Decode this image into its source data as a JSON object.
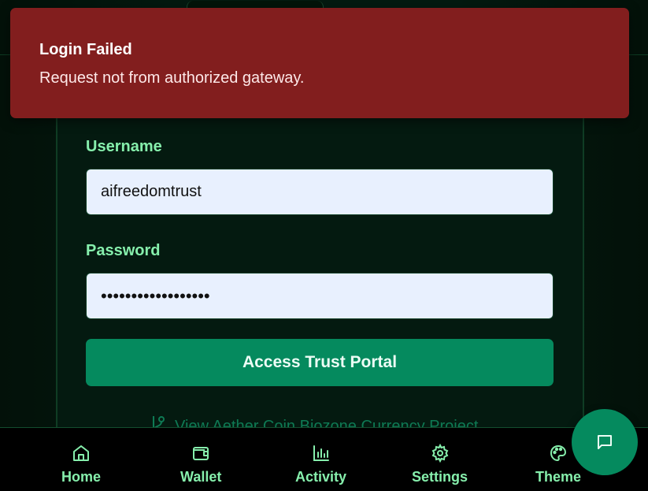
{
  "toast": {
    "title": "Login Failed",
    "message": "Request not from authorized gateway.",
    "color": "#821e1e"
  },
  "form": {
    "username_label": "Username",
    "username_value": "aifreedomtrust",
    "password_label": "Password",
    "password_value": "••••••••••••••••••",
    "submit_label": "Access Trust Portal",
    "project_link": "View Aether Coin Biozone Currency Project"
  },
  "nav": {
    "items": [
      {
        "label": "Home",
        "icon": "home-icon"
      },
      {
        "label": "Wallet",
        "icon": "wallet-icon"
      },
      {
        "label": "Activity",
        "icon": "activity-icon"
      },
      {
        "label": "Settings",
        "icon": "gear-icon"
      },
      {
        "label": "Theme",
        "icon": "palette-icon"
      }
    ]
  },
  "chat": {
    "icon": "chat-icon"
  },
  "colors": {
    "accent": "#058a5e",
    "text_green": "#86efac",
    "background": "#041a10"
  }
}
